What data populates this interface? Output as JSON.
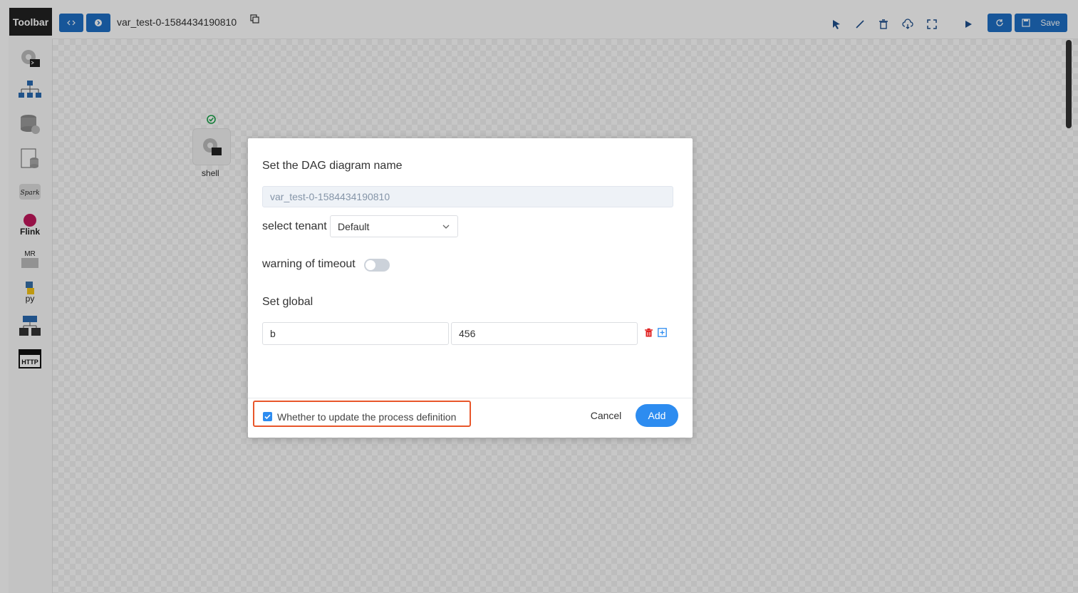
{
  "toolbar": {
    "label": "Toolbar",
    "tools": [
      {
        "name": "shell-tool-icon"
      },
      {
        "name": "sub-process-tool-icon"
      },
      {
        "name": "procedure-tool-icon"
      },
      {
        "name": "sql-tool-icon"
      },
      {
        "name": "spark-tool-icon",
        "text": "Spark"
      },
      {
        "name": "flink-tool-icon",
        "text": "Flink"
      },
      {
        "name": "mr-tool-icon",
        "text": "MR"
      },
      {
        "name": "python-tool-icon",
        "text": "py"
      },
      {
        "name": "dependent-tool-icon"
      },
      {
        "name": "http-tool-icon",
        "text": "HTTP"
      }
    ]
  },
  "header": {
    "process_name": "var_test-0-1584434190810",
    "save_label": "Save"
  },
  "canvas": {
    "node_label": "shell"
  },
  "modal": {
    "title": "Set the DAG diagram name",
    "name_value": "var_test-0-1584434190810",
    "tenant_label": "select tenant",
    "tenant_value": "Default",
    "timeout_label": "warning of timeout",
    "global_label": "Set global",
    "global_params": [
      {
        "key": "b",
        "value": "456"
      }
    ],
    "update_checkbox_label": "Whether to update the process definition",
    "cancel_label": "Cancel",
    "add_label": "Add"
  },
  "colors": {
    "primary": "#2d8cf0",
    "toolbar_blue": "#1e6fc4",
    "highlight": "#e8562a",
    "delete_red": "#e02020"
  }
}
